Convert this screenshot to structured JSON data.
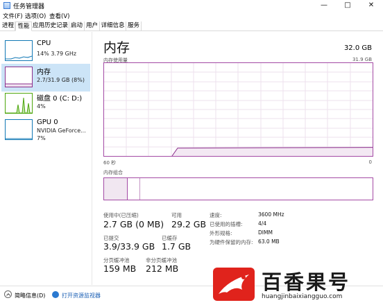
{
  "window": {
    "title": "任务管理器",
    "controls": {
      "minimize": "—",
      "maximize": "□",
      "close": "✕"
    }
  },
  "menu": [
    "文件(F)",
    "选项(O)",
    "查看(V)"
  ],
  "tabs": [
    "进程",
    "性能",
    "应用历史记录",
    "启动",
    "用户",
    "详细信息",
    "服务"
  ],
  "active_tab": "性能",
  "sidebar": {
    "items": [
      {
        "name": "CPU",
        "detail": "14%  3.79 GHz",
        "detail2": "",
        "color": "#1178b5"
      },
      {
        "name": "内存",
        "detail": "2.7/31.9 GB (8%)",
        "detail2": "",
        "color": "#8b2f8c"
      },
      {
        "name": "磁盘 0 (C: D:)",
        "detail": "4%",
        "detail2": "",
        "color": "#4da60c"
      },
      {
        "name": "GPU 0",
        "detail": "NVIDIA GeForce...",
        "detail2": "7%",
        "color": "#1178b5"
      }
    ]
  },
  "main": {
    "title": "内存",
    "total": "32.0 GB",
    "usage_label": "内存使用量",
    "usage_max": "31.9 GB",
    "axis_left": "60 秒",
    "axis_right": "0",
    "composition_label": "内存组合",
    "usage_fraction": 0.085,
    "stats": [
      {
        "label": "使用中(已压缩)",
        "value": "2.7 GB (0 MB)"
      },
      {
        "label": "可用",
        "value": "29.2 GB"
      },
      {
        "label": "已提交",
        "value": "3.9/33.9 GB"
      },
      {
        "label": "已缓存",
        "value": "1.7 GB"
      },
      {
        "label": "分页缓冲池",
        "value": "159 MB"
      },
      {
        "label": "非分页缓冲池",
        "value": "212 MB"
      }
    ],
    "details": [
      {
        "label": "速度:",
        "value": "3600 MHz"
      },
      {
        "label": "已使用的插槽:",
        "value": "4/4"
      },
      {
        "label": "外形规格:",
        "value": "DIMM"
      },
      {
        "label": "为硬件保留的内存:",
        "value": "63.0 MB"
      }
    ],
    "accent": "#8b2f8c"
  },
  "footer": {
    "less_details": "简略信息(D)",
    "open_monitor": "打开资源监视器"
  },
  "watermark": {
    "brand": "百香果号",
    "url": "huangjinbaixiangguo.com"
  }
}
